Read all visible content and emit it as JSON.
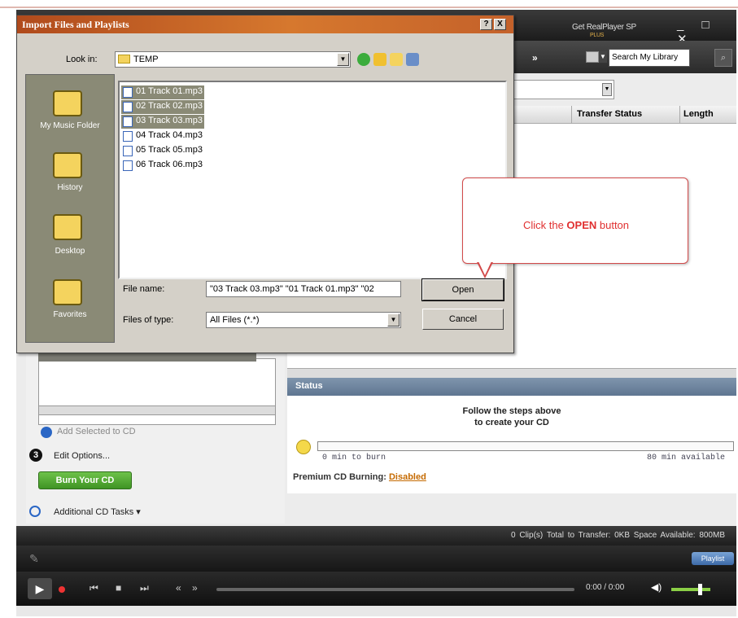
{
  "player": {
    "get_label": "Get RealPlayer SP",
    "get_sub": "PLUS",
    "more": "»",
    "search_placeholder": "Search My Library",
    "columns": {
      "transfer": "Transfer Status",
      "length": "Length"
    }
  },
  "status": {
    "heading": "Status",
    "message_line1": "Follow the steps above",
    "message_line2": "to create your CD",
    "min_to_burn": "0 min to burn",
    "min_available": "80 min available",
    "premium_label": "Premium CD Burning:",
    "premium_value": "Disabled"
  },
  "cd_panel": {
    "add_selected": "Add Selected to CD",
    "step3": "3",
    "edit_options": "Edit Options...",
    "burn_button": "Burn Your CD",
    "additional_tasks": "Additional CD Tasks"
  },
  "summary": {
    "text": "0 Clip(s)   Total to Transfer: 0KB   Space Available: 800MB"
  },
  "playbar": {
    "time": "0:00 / 0:00",
    "playlist_button": "Playlist"
  },
  "dialog": {
    "title": "Import Files and Playlists",
    "help": "?",
    "close": "X",
    "look_in_label": "Look in:",
    "look_in_value": "TEMP",
    "places": [
      "My Music Folder",
      "History",
      "Desktop",
      "Favorites"
    ],
    "files": [
      {
        "name": "01 Track 01.mp3",
        "selected": true
      },
      {
        "name": "02 Track 02.mp3",
        "selected": true
      },
      {
        "name": "03 Track 03.mp3",
        "selected": true
      },
      {
        "name": "04 Track 04.mp3",
        "selected": false
      },
      {
        "name": "05 Track 05.mp3",
        "selected": false
      },
      {
        "name": "06 Track 06.mp3",
        "selected": false
      }
    ],
    "file_name_label": "File name:",
    "file_name_value": "\"03 Track 03.mp3\" \"01 Track 01.mp3\" \"02",
    "file_type_label": "Files of type:",
    "file_type_value": "All Files (*.*)",
    "open_button": "Open",
    "cancel_button": "Cancel"
  },
  "callout": {
    "prefix": "Click the ",
    "emphasis": "OPEN",
    "suffix": " button"
  }
}
